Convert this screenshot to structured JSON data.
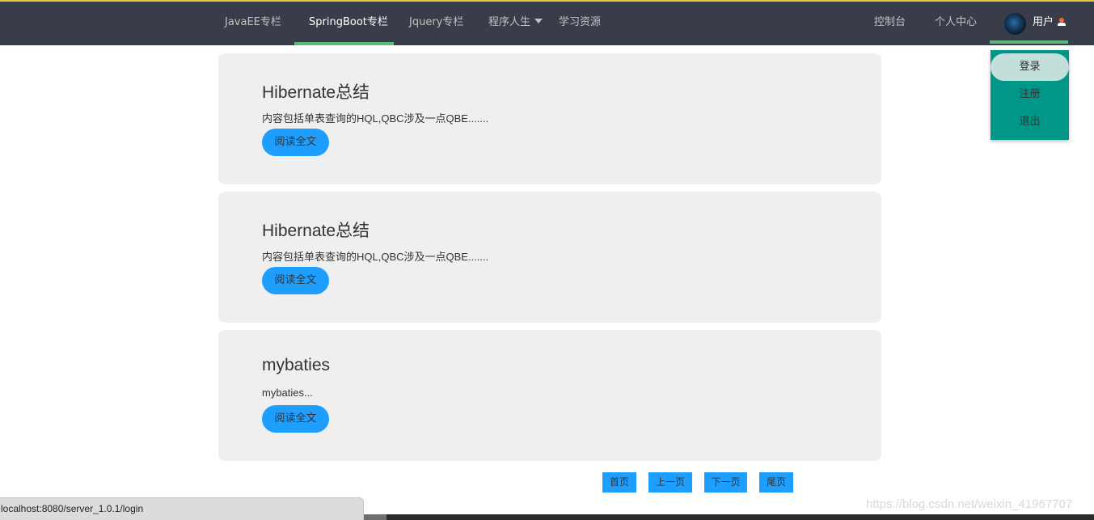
{
  "nav": {
    "items": [
      "JavaEE专栏",
      "SpringBoot专栏",
      "Jquery专栏",
      "程序人生",
      "学习资源"
    ],
    "right": [
      "控制台",
      "个人中心"
    ],
    "user_label": "用户"
  },
  "dropdown": {
    "items": [
      "登录",
      "注册",
      "退出"
    ]
  },
  "articles": [
    {
      "title": "Hibernate总结",
      "desc": "内容包括单表查询的HQL,QBC涉及一点QBE.......",
      "button": "阅读全文"
    },
    {
      "title": "Hibernate总结",
      "desc": "内容包括单表查询的HQL,QBC涉及一点QBE.......",
      "button": "阅读全文"
    },
    {
      "title": "mybaties",
      "desc": "mybaties...",
      "button": "阅读全文"
    }
  ],
  "pagination": {
    "first": "首页",
    "prev": "上一页",
    "next": "下一页",
    "last": "尾页"
  },
  "status_bar": {
    "url": "localhost:8080/server_1.0.1/login"
  },
  "watermark": "https://blog.csdn.net/weixin_41967707",
  "colors": {
    "nav_bg": "#393d49",
    "accent_green": "#5fb878",
    "dropdown_bg": "#009688",
    "button_blue": "#1e9fff",
    "card_bg": "#efefef"
  }
}
